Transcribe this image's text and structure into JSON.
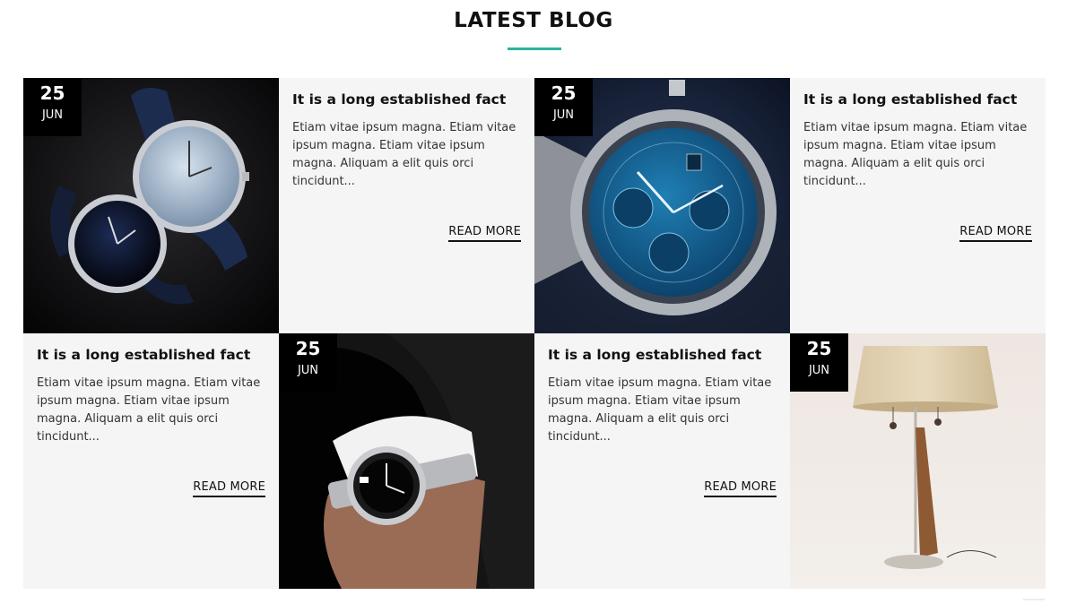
{
  "section": {
    "title": "LATEST BLOG",
    "accent_color": "#2bb39a"
  },
  "posts": [
    {
      "day": "25",
      "month": "JUN",
      "title": "It is a long established fact",
      "excerpt": "Etiam vitae ipsum magna. Etiam vitae ipsum magna. Etiam vitae ipsum magna. Aliquam a elit quis orci tincidunt...",
      "read_more": "READ MORE",
      "image": "luxury-watches-pair"
    },
    {
      "day": "25",
      "month": "JUN",
      "title": "It is a long established fact",
      "excerpt": "Etiam vitae ipsum magna. Etiam vitae ipsum magna. Etiam vitae ipsum magna. Aliquam a elit quis orci tincidunt...",
      "read_more": "READ MORE",
      "image": "blue-chronograph-watch"
    },
    {
      "day": "25",
      "month": "JUN",
      "title": "It is a long established fact",
      "excerpt": "Etiam vitae ipsum magna. Etiam vitae ipsum magna. Etiam vitae ipsum magna. Aliquam a elit quis orci tincidunt...",
      "read_more": "READ MORE",
      "image": "wrist-watch-in-suit"
    },
    {
      "day": "25",
      "month": "JUN",
      "title": "It is a long established fact",
      "excerpt": "Etiam vitae ipsum magna. Etiam vitae ipsum magna. Etiam vitae ipsum magna. Aliquam a elit quis orci tincidunt...",
      "read_more": "READ MORE",
      "image": "table-lamp"
    }
  ]
}
